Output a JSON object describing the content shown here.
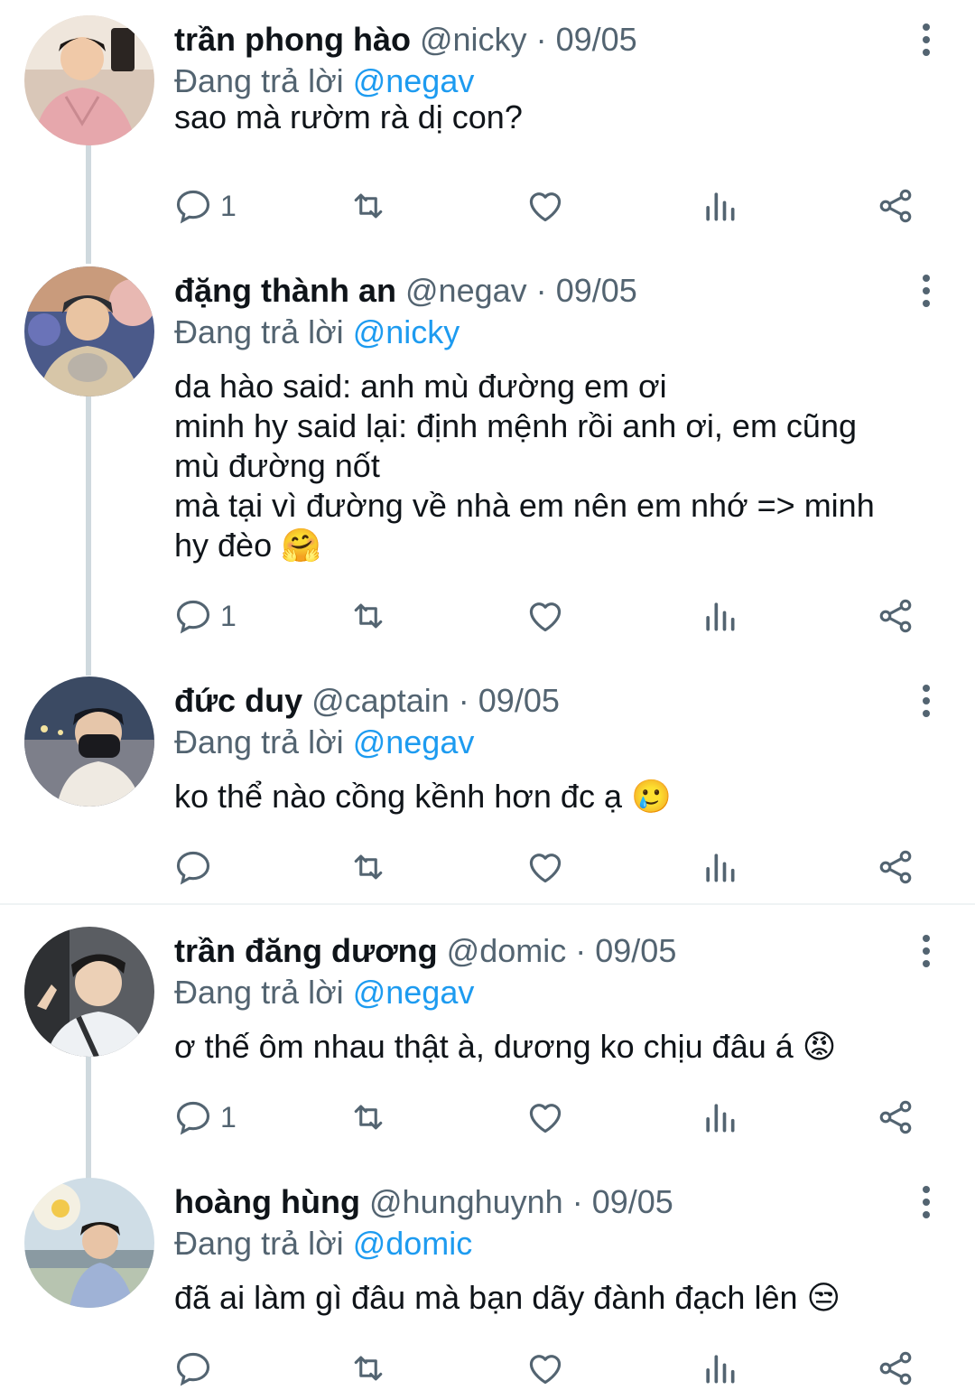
{
  "replies": [
    {
      "name": "trần phong hào",
      "handle": "@nicky",
      "separator": "·",
      "date": "09/05",
      "replying_prefix": "Đang trả lời",
      "replying_to": "@negav",
      "lines": [
        "sao mà rườm rà dị con?"
      ],
      "reply_count": "1"
    },
    {
      "name": "đặng thành an",
      "handle": "@negav",
      "separator": "·",
      "date": "09/05",
      "replying_prefix": "Đang trả lời",
      "replying_to": "@nicky",
      "lines": [
        "da hào said: anh mù đường em ơi",
        "minh hy said lại: định mệnh rồi anh ơi, em cũng",
        "mù đường nốt",
        "mà tại vì đường về nhà em nên em nhớ => minh",
        "hy đèo 🤗"
      ],
      "reply_count": "1"
    },
    {
      "name": "đức duy",
      "handle": "@captain",
      "separator": "·",
      "date": "09/05",
      "replying_prefix": "Đang trả lời",
      "replying_to": "@negav",
      "lines": [
        "ko thể nào cồng kềnh hơn đc ạ 🥲"
      ],
      "reply_count": ""
    },
    {
      "name": "trần đăng dương",
      "handle": "@domic",
      "separator": "·",
      "date": "09/05",
      "replying_prefix": "Đang trả lời",
      "replying_to": "@negav",
      "lines": [
        "ơ thế ôm nhau thật à, dương ko chịu đâu á 😡"
      ],
      "reply_count": "1"
    },
    {
      "name": "hoàng hùng",
      "handle": "@hunghuynh",
      "separator": "·",
      "date": "09/05",
      "replying_prefix": "Đang trả lời",
      "replying_to": "@domic",
      "lines": [
        "đã ai làm gì đâu mà bạn dãy đành đạch lên 😒"
      ],
      "reply_count": ""
    }
  ],
  "icons": {
    "reply": "reply-icon",
    "retweet": "retweet-icon",
    "like": "heart-icon",
    "views": "analytics-icon",
    "share": "share-icon",
    "more": "more-vertical-icon"
  },
  "colors": {
    "text": "#0f1419",
    "secondary": "#536471",
    "accent": "#1d9bf0",
    "thread_line": "#cfd9de"
  }
}
